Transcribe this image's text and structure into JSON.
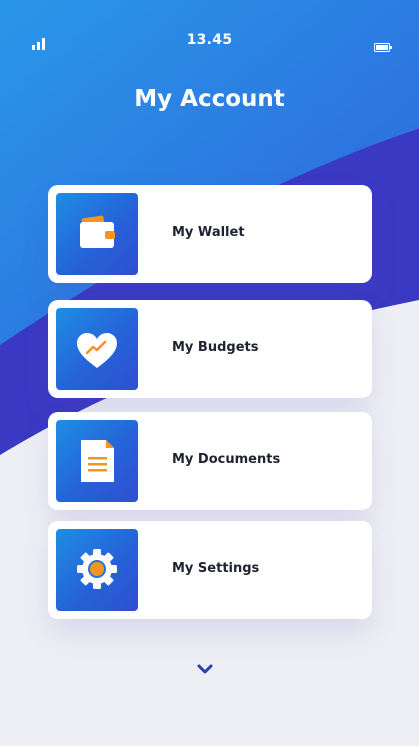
{
  "status_bar": {
    "time": "13.45",
    "signal_icon": "signal-bars-icon",
    "battery_icon": "battery-icon"
  },
  "header": {
    "title": "My Account"
  },
  "menu": {
    "items": [
      {
        "label": "My Wallet",
        "icon": "wallet-icon"
      },
      {
        "label": "My Budgets",
        "icon": "heart-chart-icon"
      },
      {
        "label": "My Documents",
        "icon": "document-icon"
      },
      {
        "label": "My Settings",
        "icon": "gear-icon"
      }
    ]
  },
  "footer": {
    "more_icon": "chevron-down-icon"
  },
  "colors": {
    "gradient_start": "#2a97ea",
    "gradient_end": "#2d5fd6",
    "band_purple": "#3a39c4",
    "background": "#eeeff4",
    "icon_accent": "#f7941d"
  }
}
